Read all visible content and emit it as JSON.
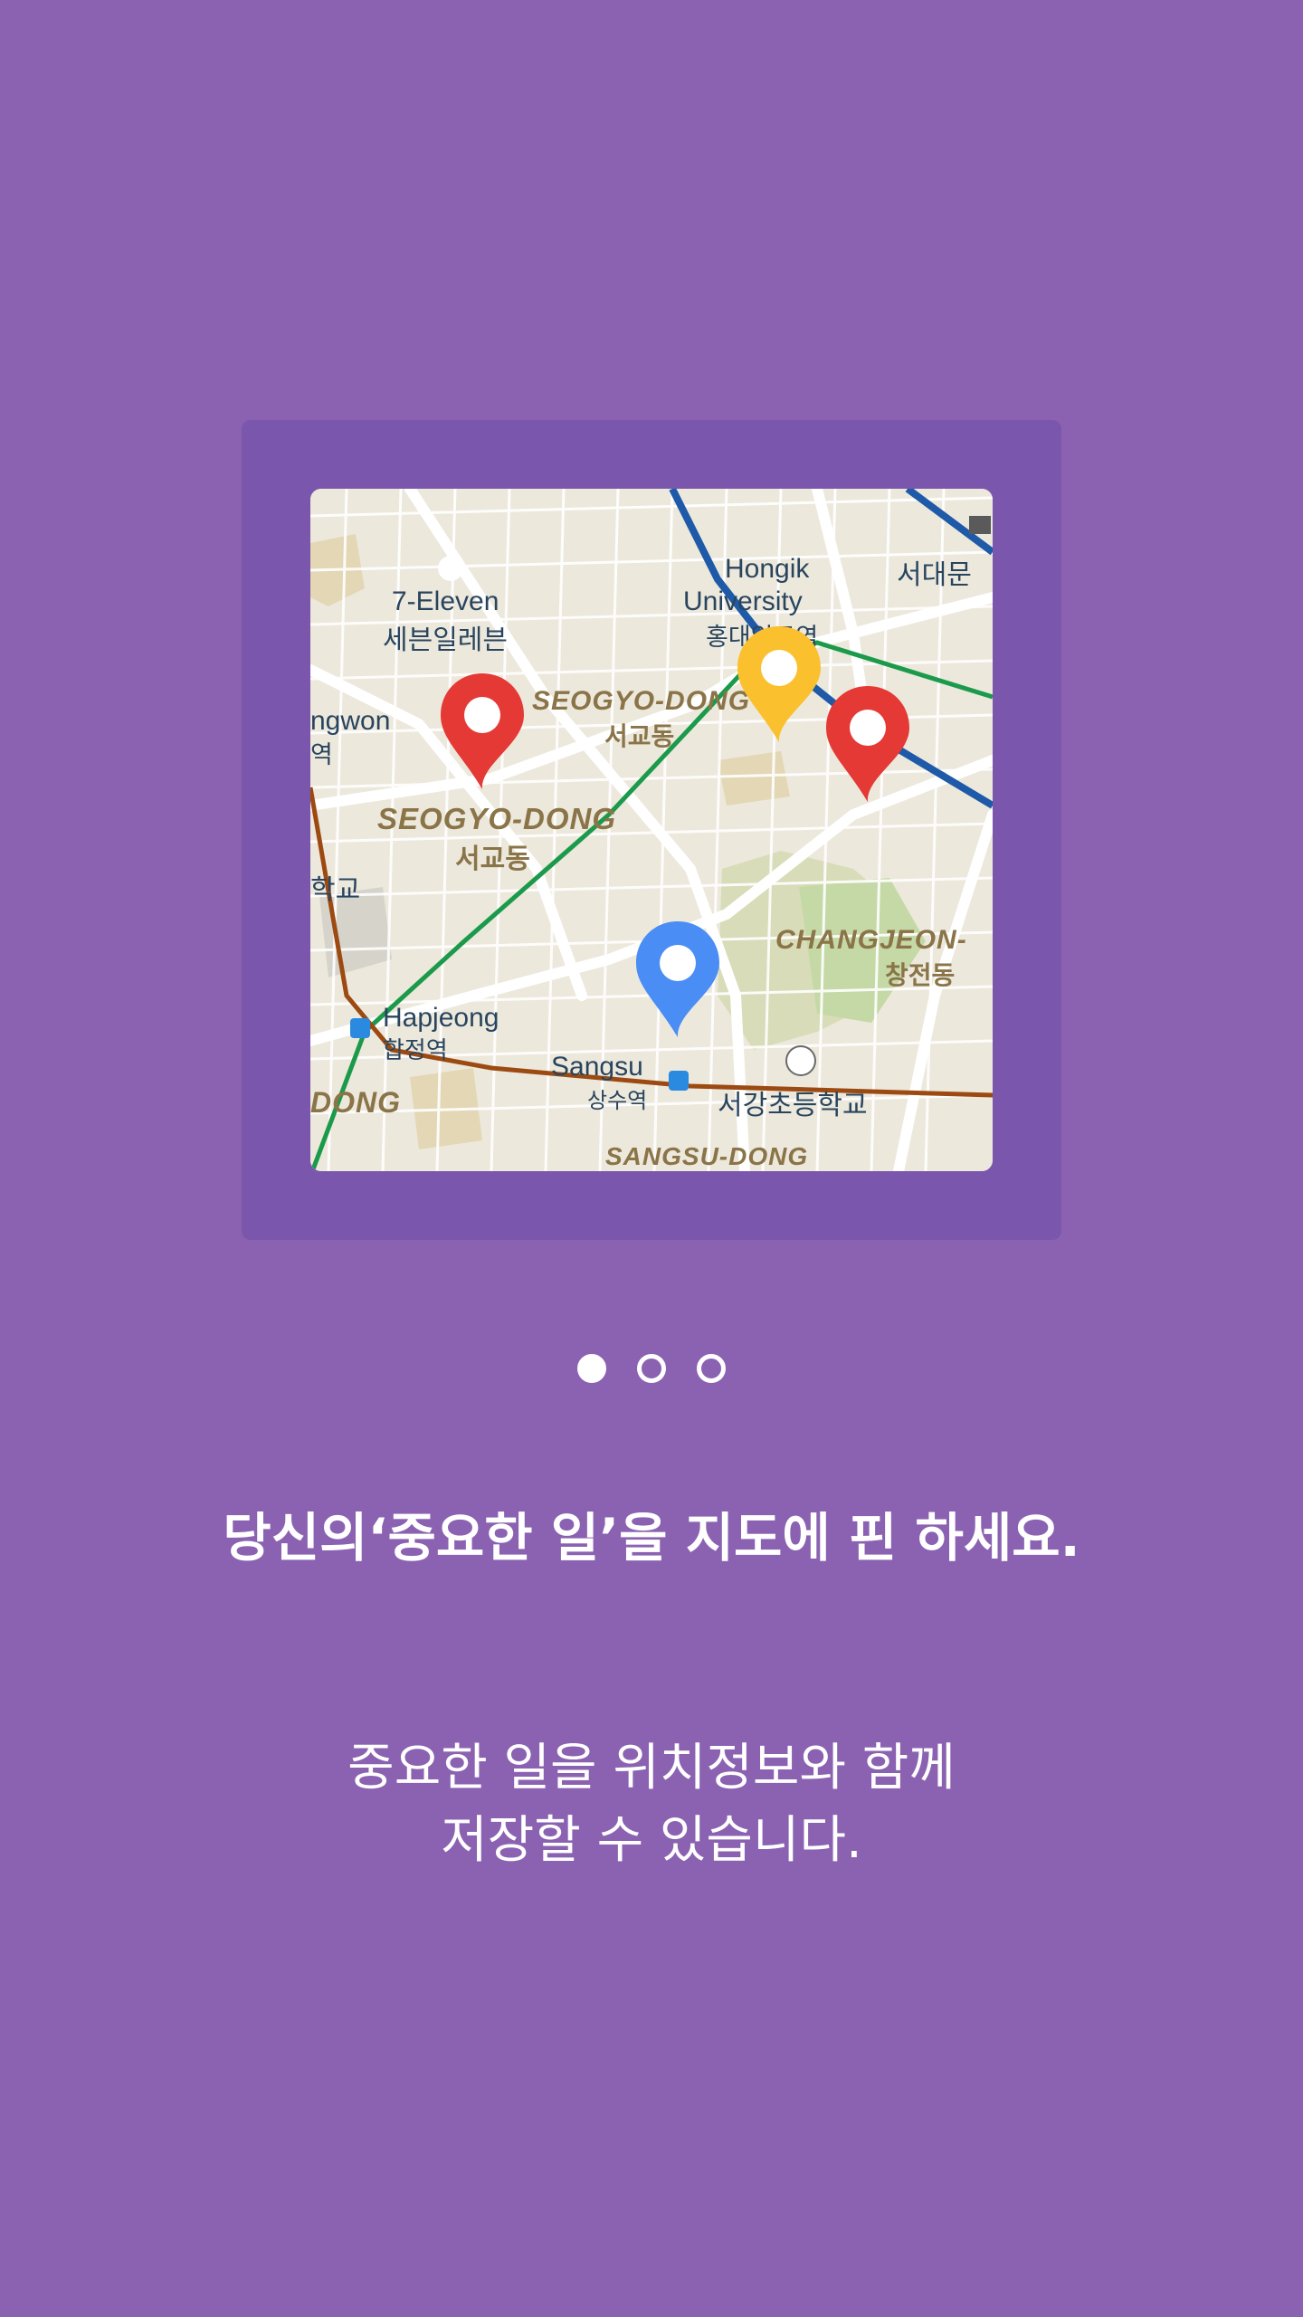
{
  "map": {
    "labels": {
      "eleven_en": "7-Eleven",
      "eleven_ko": "세븐일레븐",
      "hongik_en1": "Hongik",
      "hongik_en2": "University",
      "hongik_ko": "홍대입구역",
      "seodaemun_ko": "서대문",
      "seogyo_top_en": "SEOGYO-DONG",
      "seogyo_top_ko": "서교동",
      "seogyo_en": "SEOGYO-DONG",
      "seogyo_ko": "서교동",
      "gwon_en": "ngwon",
      "gwon_ko": "역",
      "school_left_ko": "학교",
      "changjeon_en": "CHANGJEON-",
      "changjeon_ko": "창전동",
      "hapjeong_en": "Hapjeong",
      "hapjeong_ko": "합정역",
      "sangsu_en": "Sangsu",
      "sangsu_ko": "상수역",
      "seogang_school_ko": "서강초등학교",
      "dong_en": "DONG",
      "sangsu_dong_en": "SANGSU-DONG"
    },
    "pins": [
      {
        "name": "red",
        "color": "#e53935"
      },
      {
        "name": "yellow",
        "color": "#fbc02d"
      },
      {
        "name": "red2",
        "color": "#e53935"
      },
      {
        "name": "blue",
        "color": "#4a8df5"
      }
    ]
  },
  "pager": {
    "total": 3,
    "active": 1
  },
  "headline": "당신의‘중요한 일’을  지도에 핀 하세요.",
  "description": {
    "line1": "중요한 일을 위치정보와 함께",
    "line2": "저장할 수 있습니다."
  },
  "colors": {
    "background": "#8b62b1",
    "card": "#7b56ad",
    "text": "#ffffff"
  }
}
